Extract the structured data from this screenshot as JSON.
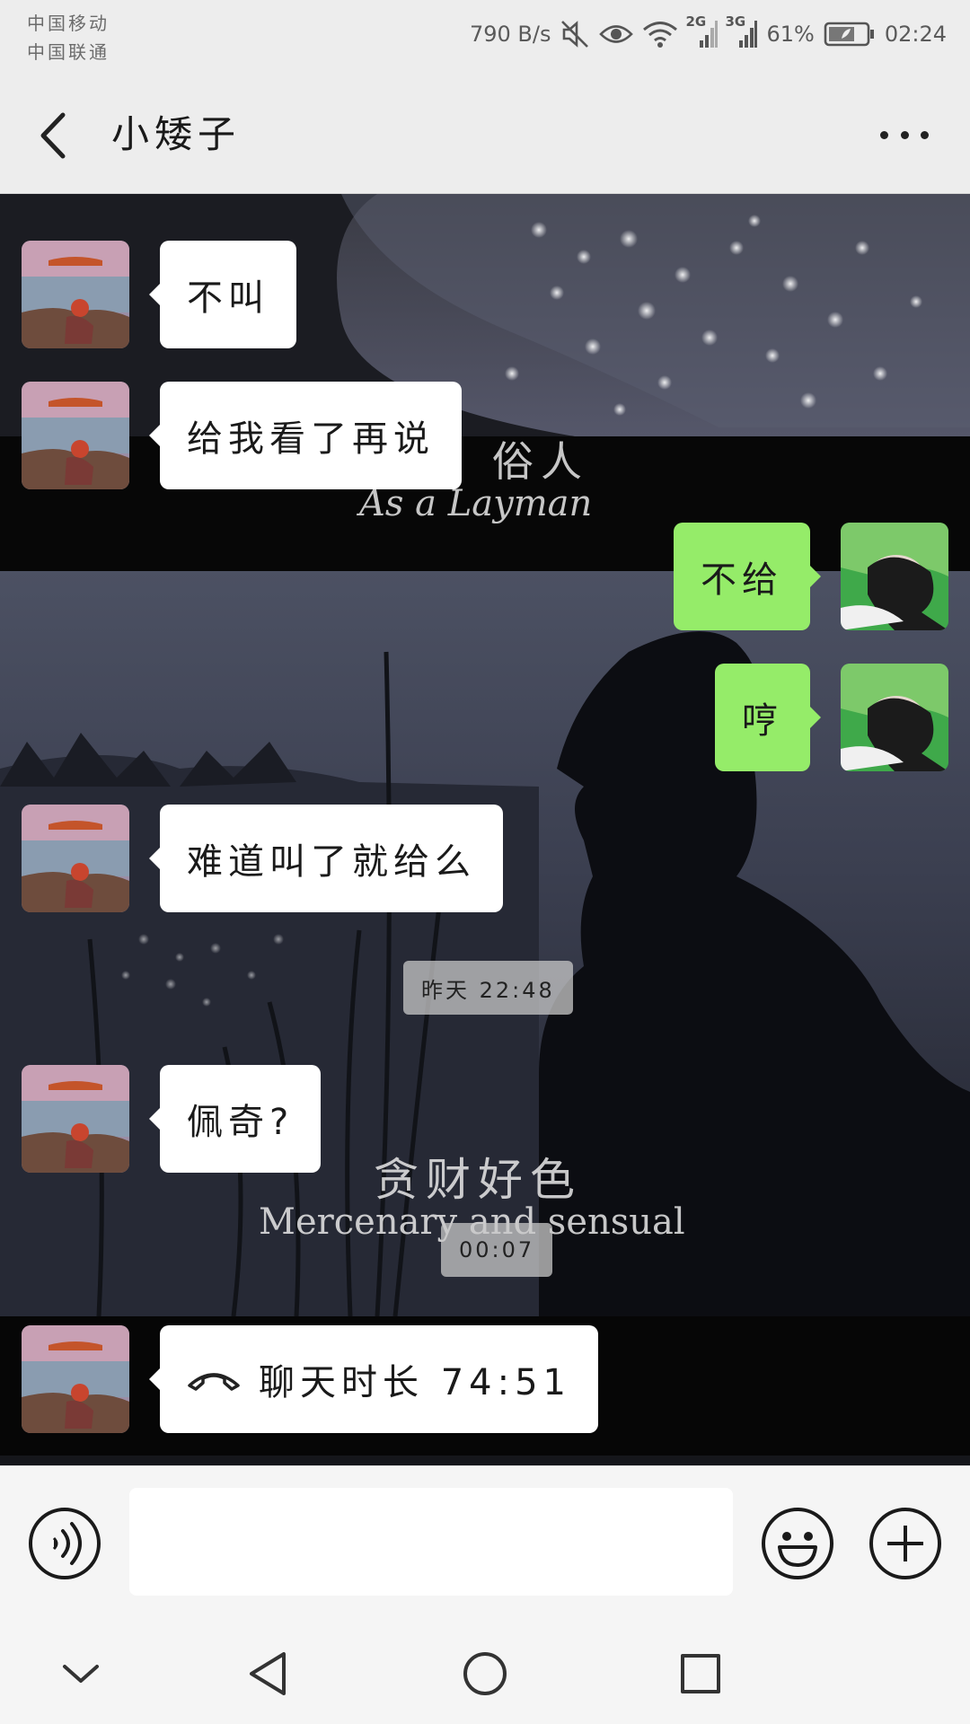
{
  "status_bar": {
    "carrier_1": "中国移动",
    "carrier_2": "中国联通",
    "net_speed": "790 B/s",
    "signal_1_type": "2G",
    "signal_2_type": "3G",
    "battery": "61%",
    "time": "02:24",
    "icons": [
      "mute-icon",
      "eye-comfort-icon",
      "wifi-icon",
      "signal-2g-icon",
      "signal-3g-icon",
      "battery-icon"
    ]
  },
  "header": {
    "title": "小矮子",
    "back_icon": "chevron-left-icon",
    "more_icon": "more-icon"
  },
  "background_overlay": {
    "line_1_cn": "俗人",
    "line_1_en": "As a Layman",
    "line_2_cn": "贪财好色",
    "line_2_en": "Mercenary and sensual"
  },
  "messages": [
    {
      "side": "left",
      "text": "不叫"
    },
    {
      "side": "left",
      "text": "给我看了再说"
    },
    {
      "side": "right",
      "text": "不给"
    },
    {
      "side": "right",
      "text": "哼"
    },
    {
      "side": "left",
      "text": "难道叫了就给么"
    },
    {
      "type": "time",
      "text": "昨天 22:48"
    },
    {
      "side": "left",
      "text": "佩奇?"
    },
    {
      "type": "time",
      "text": "00:07"
    },
    {
      "side": "left",
      "type": "call",
      "text": "聊天时长 74:51",
      "icon": "phone-hangup-icon"
    }
  ],
  "input_bar": {
    "voice_icon": "voice-icon",
    "emoji_icon": "emoji-icon",
    "plus_icon": "plus-icon",
    "placeholder": ""
  },
  "nav_bar": {
    "icons": [
      "chevron-down-icon",
      "back-triangle-icon",
      "home-circle-icon",
      "recents-square-icon"
    ]
  },
  "colors": {
    "sent_bubble": "#95ec69",
    "received_bubble": "#ffffff",
    "chrome": "#ededed"
  }
}
